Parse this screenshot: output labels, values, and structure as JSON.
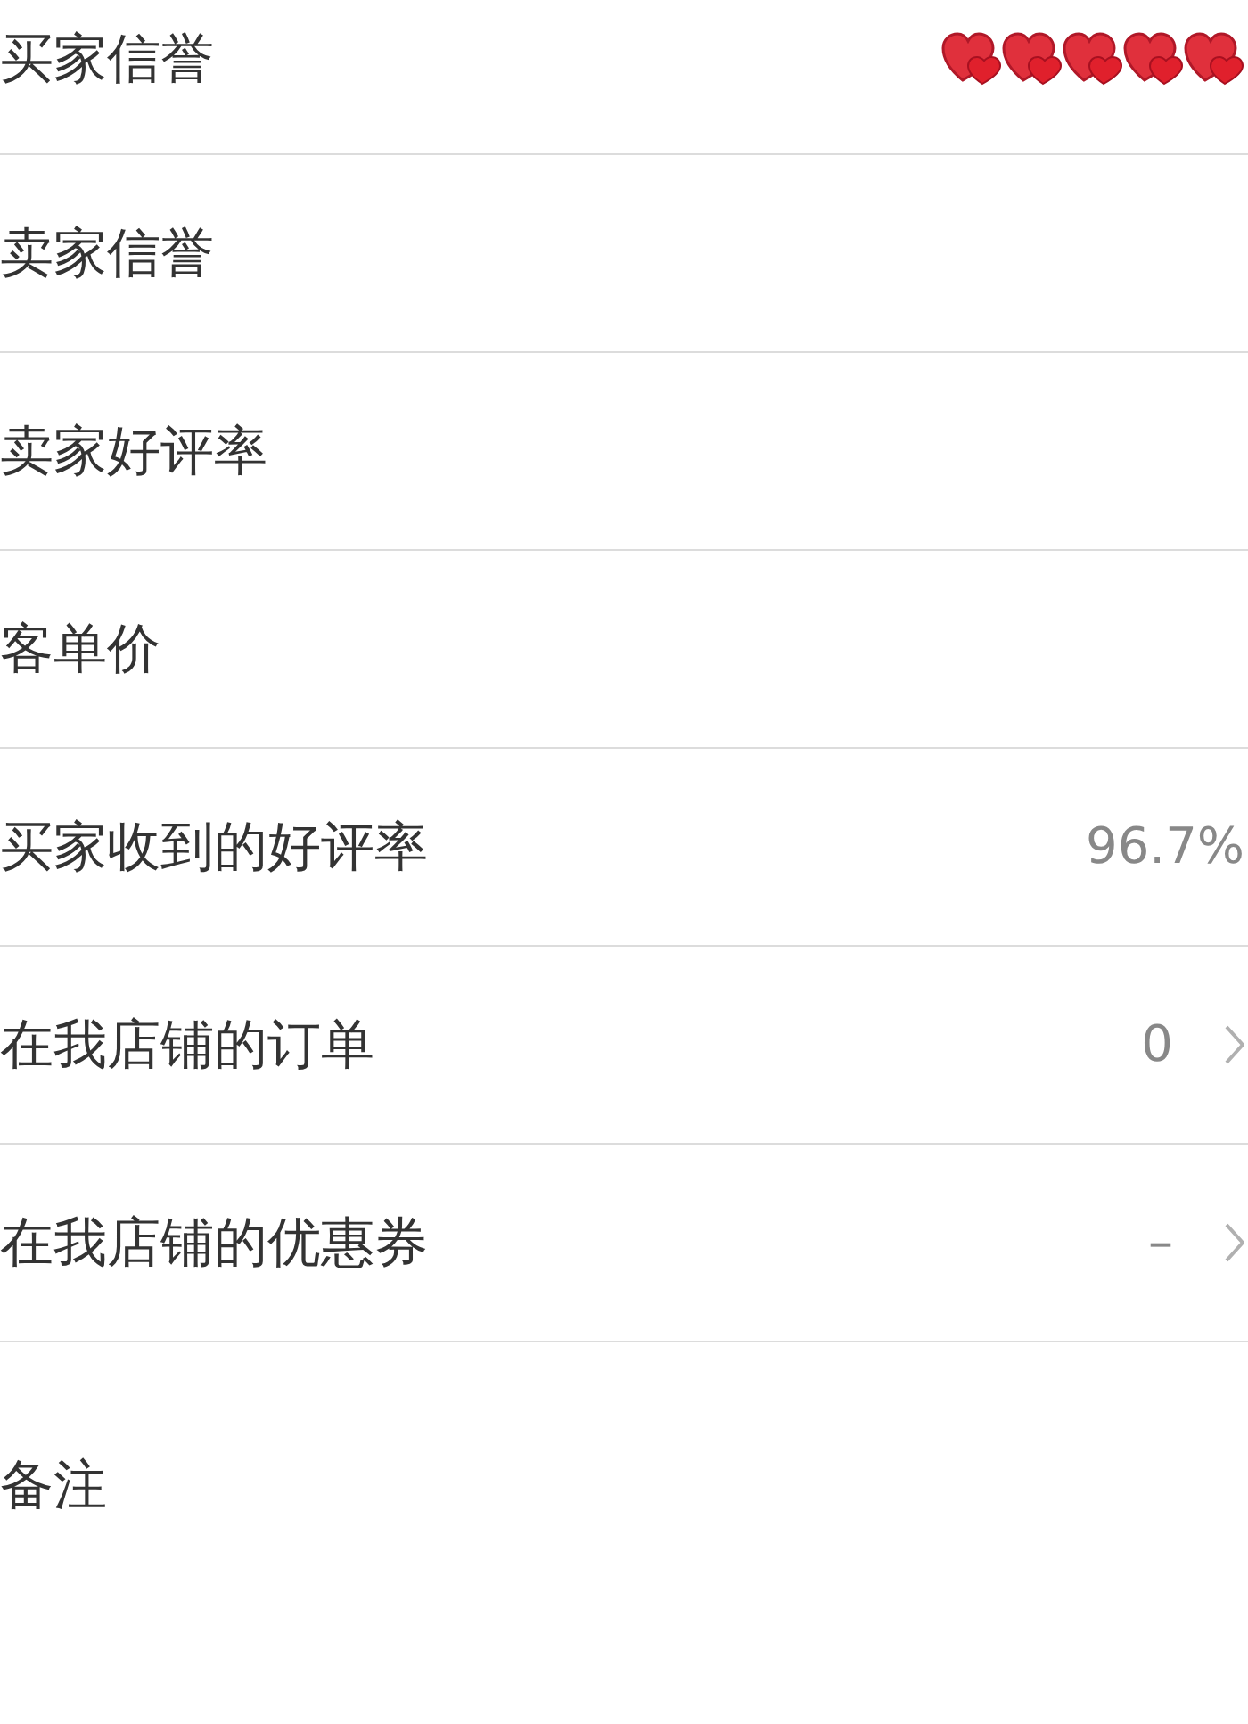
{
  "rows": [
    {
      "label": "买家信誉",
      "kind": "hearts",
      "stars": 5
    },
    {
      "label": "卖家信誉",
      "kind": "plain"
    },
    {
      "label": "卖家好评率",
      "kind": "plain"
    },
    {
      "label": "客单价",
      "kind": "plain"
    },
    {
      "label": "买家收到的好评率",
      "kind": "value",
      "value": "96.7%"
    },
    {
      "label": "在我店铺的订单",
      "kind": "link",
      "value": "0"
    },
    {
      "label": "在我店铺的优惠券",
      "kind": "link",
      "value": "–"
    }
  ],
  "note": {
    "label": "备注"
  }
}
